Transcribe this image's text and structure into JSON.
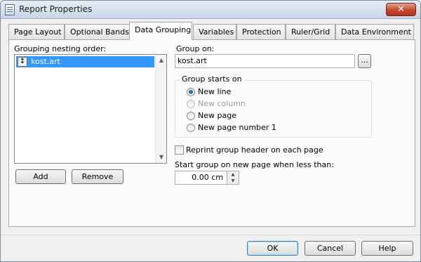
{
  "window": {
    "title": "Report Properties",
    "close_glyph": "✕"
  },
  "tabs": [
    {
      "label": "Page Layout"
    },
    {
      "label": "Optional Bands"
    },
    {
      "label": "Data Grouping"
    },
    {
      "label": "Variables"
    },
    {
      "label": "Protection"
    },
    {
      "label": "Ruler/Grid"
    },
    {
      "label": "Data Environment"
    }
  ],
  "active_tab": "Data Grouping",
  "grouping": {
    "nesting_label": "Grouping nesting order:",
    "items": [
      {
        "label": "kost.art",
        "handle_glyph": "↕"
      }
    ],
    "scroll_up_glyph": "▲",
    "scroll_down_glyph": "▼",
    "add_label": "Add",
    "remove_label": "Remove"
  },
  "group_on": {
    "label": "Group on:",
    "value": "kost.art",
    "browse_label": "..."
  },
  "group_starts_on": {
    "title": "Group starts on",
    "options": [
      {
        "label": "New line",
        "checked": true,
        "enabled": true
      },
      {
        "label": "New column",
        "checked": false,
        "enabled": false
      },
      {
        "label": "New page",
        "checked": false,
        "enabled": true
      },
      {
        "label": "New page number 1",
        "checked": false,
        "enabled": true
      }
    ]
  },
  "reprint": {
    "label": "Reprint group header on each page",
    "checked": false
  },
  "start_new_page": {
    "label": "Start group on new page when less than:",
    "value": "0.00 cm",
    "up_glyph": "▲",
    "down_glyph": "▼"
  },
  "footer": {
    "ok_label": "OK",
    "cancel_label": "Cancel",
    "help_label": "Help"
  },
  "colors": {
    "selection": "#3399ff",
    "close_button": "#c4472f",
    "dialog_bg": "#f0f0f0"
  }
}
